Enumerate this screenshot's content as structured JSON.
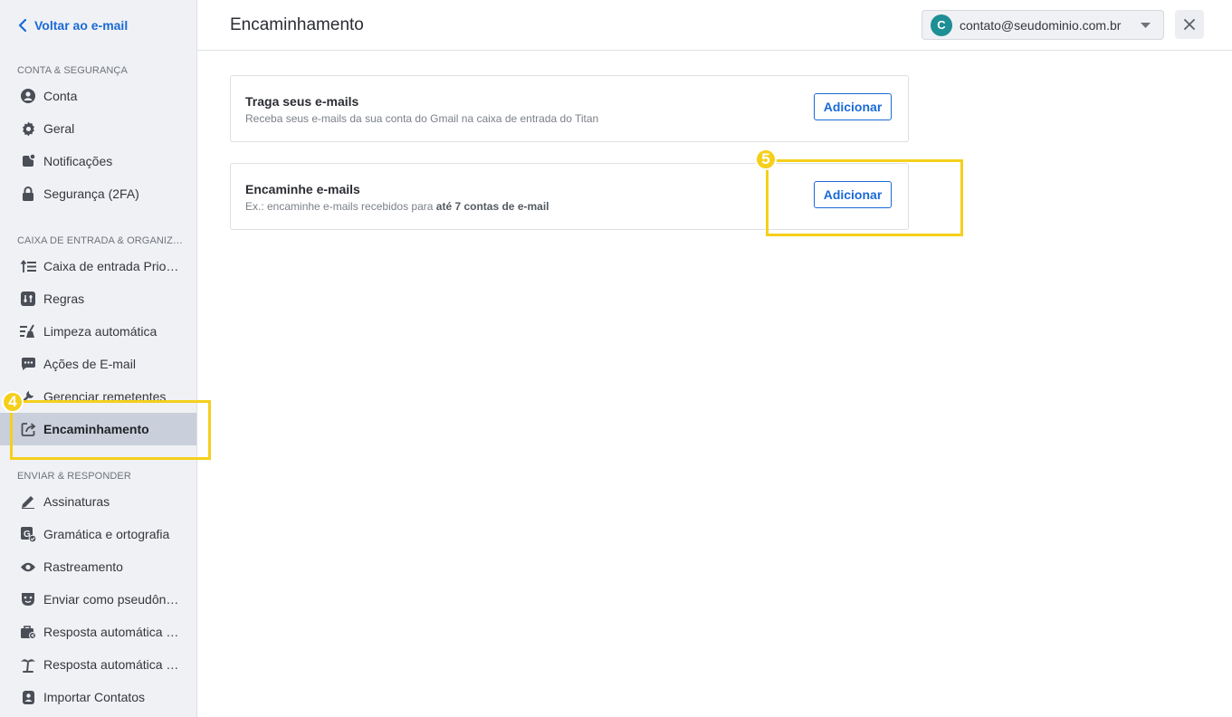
{
  "sidebar": {
    "back_label": "Voltar ao e-mail",
    "sections": [
      {
        "header": "CONTA & SEGURANÇA",
        "items": [
          {
            "label": "Conta",
            "icon": "account-icon"
          },
          {
            "label": "Geral",
            "icon": "gear-icon"
          },
          {
            "label": "Notificações",
            "icon": "notification-icon"
          },
          {
            "label": "Segurança (2FA)",
            "icon": "lock-icon"
          }
        ]
      },
      {
        "header": "CAIXA DE ENTRADA & ORGANIZAÇÃO",
        "items": [
          {
            "label": "Caixa de entrada Prioritária",
            "icon": "priority-inbox-icon"
          },
          {
            "label": "Regras",
            "icon": "rules-icon"
          },
          {
            "label": "Limpeza automática",
            "icon": "broom-icon"
          },
          {
            "label": "Ações de E-mail",
            "icon": "email-actions-icon"
          },
          {
            "label": "Gerenciar remetentes",
            "icon": "wrench-icon"
          },
          {
            "label": "Encaminhamento",
            "icon": "forward-icon",
            "active": true
          }
        ]
      },
      {
        "header": "ENVIAR & RESPONDER",
        "items": [
          {
            "label": "Assinaturas",
            "icon": "pen-icon"
          },
          {
            "label": "Gramática e ortografia",
            "icon": "grammar-icon"
          },
          {
            "label": "Rastreamento",
            "icon": "eye-icon"
          },
          {
            "label": "Enviar como pseudônimo",
            "icon": "mask-icon"
          },
          {
            "label": "Resposta automática (trabalho)",
            "icon": "briefcase-icon"
          },
          {
            "label": "Resposta automática (férias)",
            "icon": "palm-tree-icon"
          },
          {
            "label": "Importar Contatos",
            "icon": "contacts-icon"
          }
        ]
      }
    ]
  },
  "header": {
    "title": "Encaminhamento",
    "account_initial": "C",
    "account_email": "contato@seudominio.com.br"
  },
  "cards": [
    {
      "title": "Traga seus e-mails",
      "description": "Receba seus e-mails da sua conta do Gmail na caixa de entrada do Titan",
      "button": "Adicionar"
    },
    {
      "title": "Encaminhe e-mails",
      "description_prefix": "Ex.: encaminhe e-mails recebidos para ",
      "description_bold": "até 7 contas de e-mail",
      "button": "Adicionar"
    }
  ],
  "annotations": {
    "step4": "4",
    "step5": "5"
  },
  "colors": {
    "accent": "#1b6ad6",
    "highlight": "#f5cf1b",
    "avatar": "#1d8f95"
  }
}
